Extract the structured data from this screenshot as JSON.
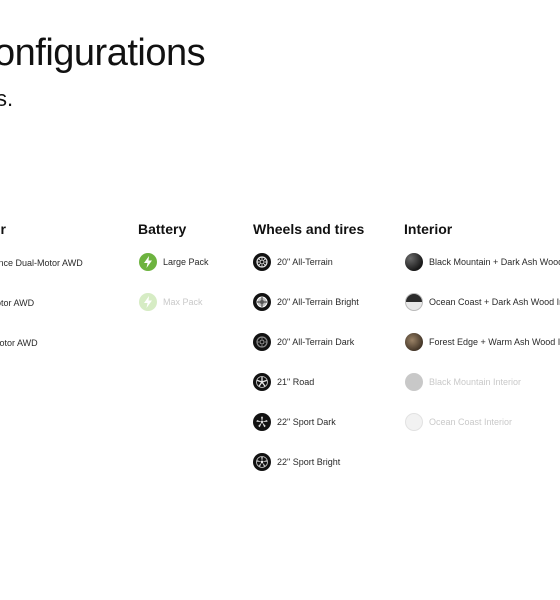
{
  "header": {
    "title": "onfigurations",
    "subtitle": "s."
  },
  "columns": {
    "motor": {
      "title": "or",
      "items": [
        {
          "label": "mance Dual-Motor AWD"
        },
        {
          "label": "lotor AWD"
        },
        {
          "label": "Motor AWD"
        }
      ]
    },
    "battery": {
      "title": "Battery",
      "items": [
        {
          "label": "Large Pack",
          "icon": "lightning-bolt-icon",
          "enabled": true
        },
        {
          "label": "Max Pack",
          "icon": "lightning-bolt-icon",
          "enabled": false
        }
      ]
    },
    "wheels": {
      "title": "Wheels and tires",
      "items": [
        {
          "label": "20\" All-Terrain",
          "icon": "wheel-all-terrain-icon"
        },
        {
          "label": "20\" All-Terrain Bright",
          "icon": "wheel-all-terrain-bright-icon"
        },
        {
          "label": "20\" All-Terrain Dark",
          "icon": "wheel-all-terrain-dark-icon"
        },
        {
          "label": "21\" Road",
          "icon": "wheel-road-icon"
        },
        {
          "label": "22\" Sport Dark",
          "icon": "wheel-sport-dark-icon"
        },
        {
          "label": "22\" Sport Bright",
          "icon": "wheel-sport-bright-icon"
        }
      ]
    },
    "interior": {
      "title": "Interior",
      "items": [
        {
          "label": "Black Mountain + Dark Ash Wood",
          "swatch": "black-mountain-dark-ash-swatch",
          "enabled": true
        },
        {
          "label": "Ocean Coast + Dark Ash Wood In",
          "swatch": "ocean-coast-dark-ash-swatch",
          "enabled": true
        },
        {
          "label": "Forest Edge + Warm Ash Wood In",
          "swatch": "forest-edge-warm-ash-swatch",
          "enabled": true
        },
        {
          "label": "Black Mountain Interior",
          "swatch": "black-mountain-swatch",
          "enabled": false
        },
        {
          "label": "Ocean Coast Interior",
          "swatch": "ocean-coast-swatch",
          "enabled": false
        }
      ]
    }
  },
  "colors": {
    "battery_green": "#6db33f",
    "disabled_text": "#c9c9c9"
  }
}
